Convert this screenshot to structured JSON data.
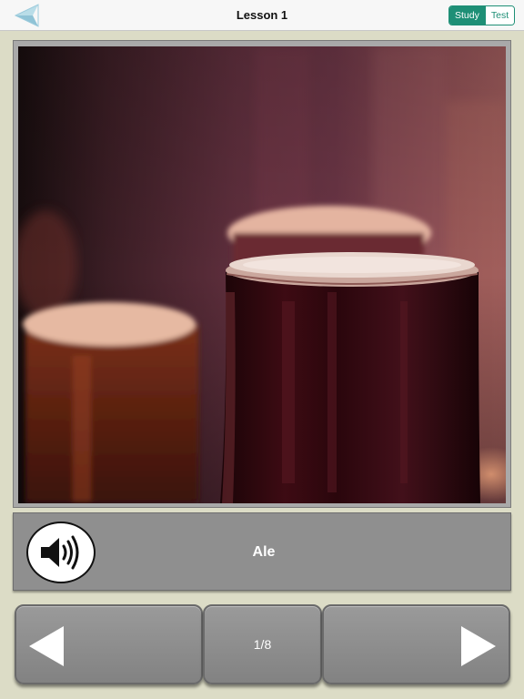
{
  "header": {
    "title": "Lesson 1",
    "modes": [
      "Study",
      "Test"
    ],
    "active_mode": "Study"
  },
  "flashcard": {
    "word": "Ale",
    "image_icon": "photo-glasses-of-ale",
    "audio_icon": "speaker-icon"
  },
  "pager": {
    "counter": "1/8",
    "prev_icon": "triangle-left-icon",
    "next_icon": "triangle-right-icon"
  },
  "colors": {
    "accent": "#1e8f76",
    "background": "#dcdcc6",
    "panel": "#8f8f8f"
  }
}
